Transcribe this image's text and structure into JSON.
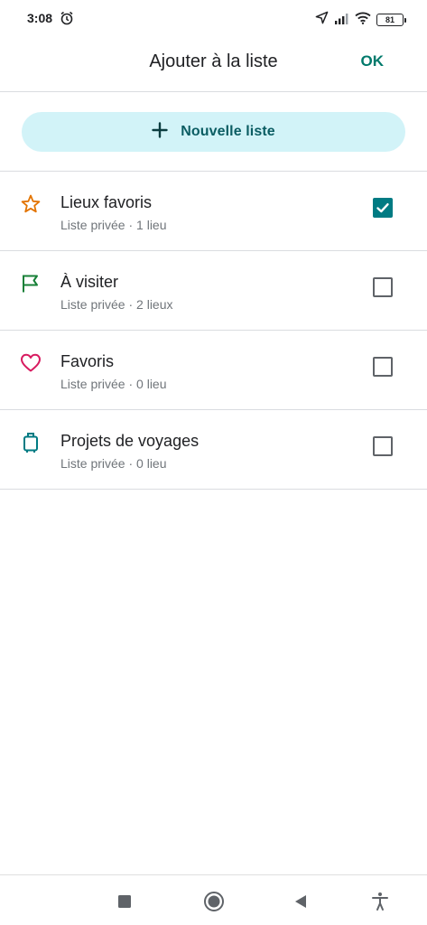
{
  "status_bar": {
    "time": "3:08",
    "battery": "81",
    "icons": [
      "alarm-icon",
      "location-icon",
      "signal-icon",
      "wifi-icon",
      "battery-icon"
    ]
  },
  "header": {
    "title": "Ajouter à la liste",
    "ok_label": "OK"
  },
  "new_list": {
    "label": "Nouvelle liste",
    "icon": "plus-icon"
  },
  "lists": [
    {
      "title": "Lieux favoris",
      "subtitle": "Liste privée · 1 lieu",
      "icon": "star-icon",
      "icon_color": "#e37400",
      "checked": true
    },
    {
      "title": "À visiter",
      "subtitle": "Liste privée · 2 lieux",
      "icon": "flag-icon",
      "icon_color": "#188038",
      "checked": false
    },
    {
      "title": "Favoris",
      "subtitle": "Liste privée · 0 lieu",
      "icon": "heart-icon",
      "icon_color": "#d81b60",
      "checked": false
    },
    {
      "title": "Projets de voyages",
      "subtitle": "Liste privée · 0 lieu",
      "icon": "luggage-icon",
      "icon_color": "#007b83",
      "checked": false
    }
  ],
  "colors": {
    "accent": "#00796b",
    "checkbox_checked": "#007b83",
    "new_list_bg": "#d2f3f8"
  },
  "nav_bar": {
    "icons": [
      "recents-icon",
      "home-icon",
      "back-icon",
      "accessibility-icon"
    ]
  }
}
